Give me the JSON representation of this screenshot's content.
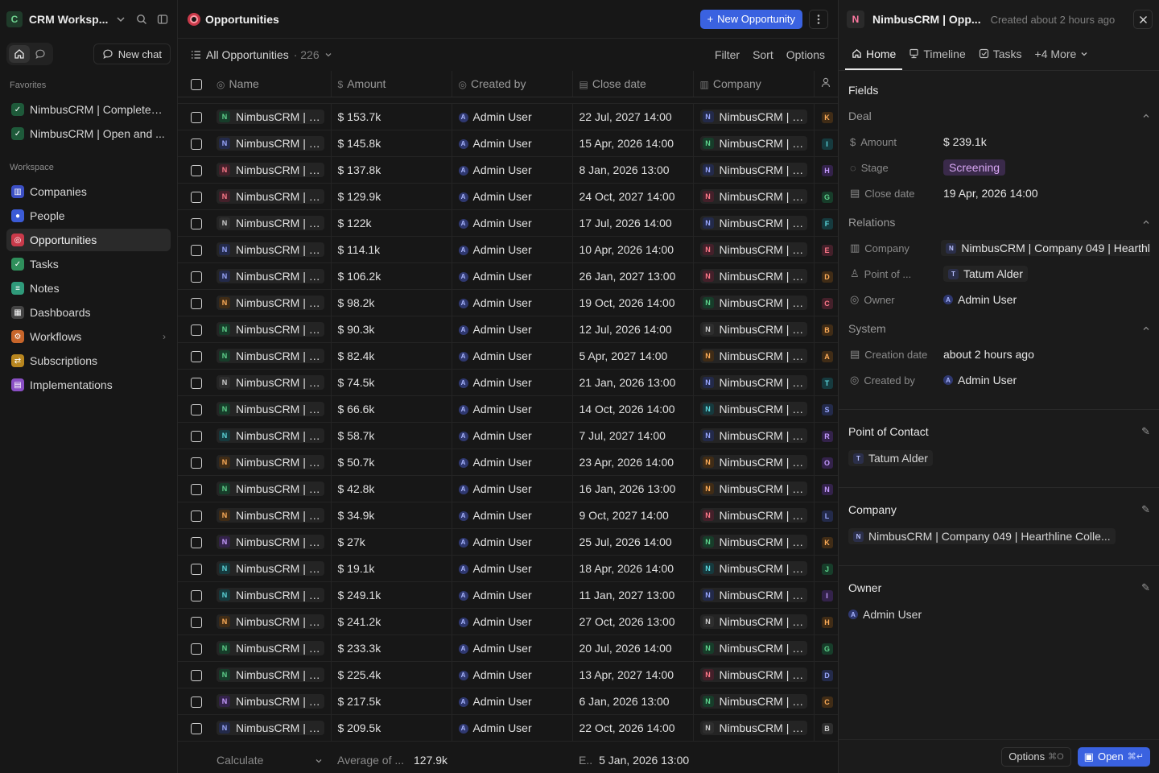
{
  "sidebar": {
    "workspace_initial": "C",
    "workspace_name": "CRM Worksp...",
    "new_chat_label": "New chat",
    "favorites_title": "Favorites",
    "favorites": [
      {
        "label": "NimbusCRM | Completed ...",
        "color": "#1e5a3a"
      },
      {
        "label": "NimbusCRM | Open and ...",
        "color": "#1e5a3a"
      }
    ],
    "workspace_title": "Workspace",
    "items": [
      {
        "label": "Companies",
        "icon": "building-icon",
        "color": "#3b4fc4",
        "glyph": "▥",
        "active": false,
        "chevron": ""
      },
      {
        "label": "People",
        "icon": "person-icon",
        "color": "#3b5bd6",
        "glyph": "●",
        "active": false,
        "chevron": ""
      },
      {
        "label": "Opportunities",
        "icon": "target-icon",
        "color": "#c93a4a",
        "glyph": "◎",
        "active": true,
        "chevron": ""
      },
      {
        "label": "Tasks",
        "icon": "checkbox-icon",
        "color": "#2f8f5b",
        "glyph": "✓",
        "active": false,
        "chevron": ""
      },
      {
        "label": "Notes",
        "icon": "note-icon",
        "color": "#2f9a7a",
        "glyph": "≡",
        "active": false,
        "chevron": ""
      },
      {
        "label": "Dashboards",
        "icon": "dashboard-icon",
        "color": "#444444",
        "glyph": "▦",
        "active": false,
        "chevron": ""
      },
      {
        "label": "Workflows",
        "icon": "workflow-icon",
        "color": "#c7652a",
        "glyph": "⚙",
        "active": false,
        "chevron": "›"
      },
      {
        "label": "Subscriptions",
        "icon": "subscription-icon",
        "color": "#b8861f",
        "glyph": "⇄",
        "active": false,
        "chevron": ""
      },
      {
        "label": "Implementations",
        "icon": "implementation-icon",
        "color": "#8a4fc4",
        "glyph": "▤",
        "active": false,
        "chevron": ""
      }
    ]
  },
  "main": {
    "title": "Opportunities",
    "new_button": "New Opportunity",
    "view_name": "All Opportunities",
    "view_count": "· 226",
    "filter": "Filter",
    "sort": "Sort",
    "options": "Options",
    "columns": [
      "Name",
      "Amount",
      "Created by",
      "Close date",
      "Company"
    ],
    "rows": [
      {
        "name": "NimbusCRM | Op...",
        "nc": "g",
        "amount": "$ 153.7k",
        "by": "Admin User",
        "date": "22 Jul, 2027 14:00",
        "company": "NimbusCRM | Co...",
        "cc": "b",
        "p": "K",
        "pc": "o"
      },
      {
        "name": "NimbusCRM | Op...",
        "nc": "b",
        "amount": "$ 145.8k",
        "by": "Admin User",
        "date": "15 Apr, 2026 14:00",
        "company": "NimbusCRM | Co...",
        "cc": "g",
        "p": "I",
        "pc": "c"
      },
      {
        "name": "NimbusCRM | Op...",
        "nc": "r",
        "amount": "$ 137.8k",
        "by": "Admin User",
        "date": "8 Jan, 2026 13:00",
        "company": "NimbusCRM | Co...",
        "cc": "b",
        "p": "H",
        "pc": "v"
      },
      {
        "name": "NimbusCRM | Op...",
        "nc": "r",
        "amount": "$ 129.9k",
        "by": "Admin User",
        "date": "24 Oct, 2027 14:00",
        "company": "NimbusCRM | Co...",
        "cc": "r",
        "p": "G",
        "pc": "g"
      },
      {
        "name": "NimbusCRM | Op...",
        "nc": "w",
        "amount": "$ 122k",
        "by": "Admin User",
        "date": "17 Jul, 2026 14:00",
        "company": "NimbusCRM | Co...",
        "cc": "b",
        "p": "F",
        "pc": "c"
      },
      {
        "name": "NimbusCRM | Op...",
        "nc": "b",
        "amount": "$ 114.1k",
        "by": "Admin User",
        "date": "10 Apr, 2026 14:00",
        "company": "NimbusCRM | Co...",
        "cc": "r",
        "p": "E",
        "pc": "r"
      },
      {
        "name": "NimbusCRM | Op...",
        "nc": "b",
        "amount": "$ 106.2k",
        "by": "Admin User",
        "date": "26 Jan, 2027 13:00",
        "company": "NimbusCRM | Co...",
        "cc": "r",
        "p": "D",
        "pc": "o"
      },
      {
        "name": "NimbusCRM | Op...",
        "nc": "o",
        "amount": "$ 98.2k",
        "by": "Admin User",
        "date": "19 Oct, 2026 14:00",
        "company": "NimbusCRM | Co...",
        "cc": "g",
        "p": "C",
        "pc": "r"
      },
      {
        "name": "NimbusCRM | Op...",
        "nc": "g",
        "amount": "$ 90.3k",
        "by": "Admin User",
        "date": "12 Jul, 2026 14:00",
        "company": "NimbusCRM | Co...",
        "cc": "w",
        "p": "B",
        "pc": "o"
      },
      {
        "name": "NimbusCRM | Op...",
        "nc": "g",
        "amount": "$ 82.4k",
        "by": "Admin User",
        "date": "5 Apr, 2027 14:00",
        "company": "NimbusCRM | Co...",
        "cc": "o",
        "p": "A",
        "pc": "o"
      },
      {
        "name": "NimbusCRM | Op...",
        "nc": "w",
        "amount": "$ 74.5k",
        "by": "Admin User",
        "date": "21 Jan, 2026 13:00",
        "company": "NimbusCRM | Co...",
        "cc": "b",
        "p": "T",
        "pc": "c"
      },
      {
        "name": "NimbusCRM | Op...",
        "nc": "g",
        "amount": "$ 66.6k",
        "by": "Admin User",
        "date": "14 Oct, 2026 14:00",
        "company": "NimbusCRM | Co...",
        "cc": "c",
        "p": "S",
        "pc": "b"
      },
      {
        "name": "NimbusCRM | Op...",
        "nc": "c",
        "amount": "$ 58.7k",
        "by": "Admin User",
        "date": "7 Jul, 2027 14:00",
        "company": "NimbusCRM | Co...",
        "cc": "b",
        "p": "R",
        "pc": "v"
      },
      {
        "name": "NimbusCRM | Op...",
        "nc": "o",
        "amount": "$ 50.7k",
        "by": "Admin User",
        "date": "23 Apr, 2026 14:00",
        "company": "NimbusCRM | Co...",
        "cc": "o",
        "p": "O",
        "pc": "v"
      },
      {
        "name": "NimbusCRM | Op...",
        "nc": "g",
        "amount": "$ 42.8k",
        "by": "Admin User",
        "date": "16 Jan, 2026 13:00",
        "company": "NimbusCRM | Co...",
        "cc": "o",
        "p": "N",
        "pc": "v"
      },
      {
        "name": "NimbusCRM | Op...",
        "nc": "o",
        "amount": "$ 34.9k",
        "by": "Admin User",
        "date": "9 Oct, 2027 14:00",
        "company": "NimbusCRM | Co...",
        "cc": "r",
        "p": "L",
        "pc": "b"
      },
      {
        "name": "NimbusCRM | Op...",
        "nc": "v",
        "amount": "$ 27k",
        "by": "Admin User",
        "date": "25 Jul, 2026 14:00",
        "company": "NimbusCRM | Co...",
        "cc": "g",
        "p": "K",
        "pc": "o"
      },
      {
        "name": "NimbusCRM | Op...",
        "nc": "c",
        "amount": "$ 19.1k",
        "by": "Admin User",
        "date": "18 Apr, 2026 14:00",
        "company": "NimbusCRM | Co...",
        "cc": "c",
        "p": "J",
        "pc": "g"
      },
      {
        "name": "NimbusCRM | Op...",
        "nc": "c",
        "amount": "$ 249.1k",
        "by": "Admin User",
        "date": "11 Jan, 2027 13:00",
        "company": "NimbusCRM | Co...",
        "cc": "b",
        "p": "I",
        "pc": "v"
      },
      {
        "name": "NimbusCRM | Op...",
        "nc": "o",
        "amount": "$ 241.2k",
        "by": "Admin User",
        "date": "27 Oct, 2026 13:00",
        "company": "NimbusCRM | Co...",
        "cc": "w",
        "p": "H",
        "pc": "o"
      },
      {
        "name": "NimbusCRM | Op...",
        "nc": "g",
        "amount": "$ 233.3k",
        "by": "Admin User",
        "date": "20 Jul, 2026 14:00",
        "company": "NimbusCRM | Co...",
        "cc": "g",
        "p": "G",
        "pc": "g"
      },
      {
        "name": "NimbusCRM | Op...",
        "nc": "g",
        "amount": "$ 225.4k",
        "by": "Admin User",
        "date": "13 Apr, 2027 14:00",
        "company": "NimbusCRM | Co...",
        "cc": "r",
        "p": "D",
        "pc": "b"
      },
      {
        "name": "NimbusCRM | Op...",
        "nc": "v",
        "amount": "$ 217.5k",
        "by": "Admin User",
        "date": "6 Jan, 2026 13:00",
        "company": "NimbusCRM | Co...",
        "cc": "g",
        "p": "C",
        "pc": "o"
      },
      {
        "name": "NimbusCRM | Op...",
        "nc": "b",
        "amount": "$ 209.5k",
        "by": "Admin User",
        "date": "22 Oct, 2026 14:00",
        "company": "NimbusCRM | Co...",
        "cc": "w",
        "p": "B",
        "pc": "w"
      }
    ],
    "footer": {
      "calculate": "Calculate",
      "average_label": "Average of ...",
      "average_value": "127.9k",
      "earliest_label": "E..",
      "earliest_value": "5 Jan, 2026 13:00"
    }
  },
  "panel": {
    "badge": "N",
    "title": "NimbusCRM | Opp...",
    "subtitle": "Created about 2 hours ago",
    "tabs": [
      "Home",
      "Timeline",
      "Tasks",
      "+4 More"
    ],
    "fields_title": "Fields",
    "deal_title": "Deal",
    "amount_label": "Amount",
    "amount_value": "$ 239.1k",
    "stage_label": "Stage",
    "stage_value": "Screening",
    "close_label": "Close date",
    "close_value": "19 Apr, 2026 14:00",
    "relations_title": "Relations",
    "company_label": "Company",
    "company_value": "NimbusCRM | Company 049 | Hearthl",
    "poc_label": "Point of ...",
    "poc_value": "Tatum Alder",
    "owner_label": "Owner",
    "owner_value": "Admin User",
    "system_title": "System",
    "creation_label": "Creation date",
    "creation_value": "about 2 hours ago",
    "createdby_label": "Created by",
    "createdby_value": "Admin User",
    "card_poc_title": "Point of Contact",
    "card_poc_value": "Tatum Alder",
    "card_company_title": "Company",
    "card_company_value": "NimbusCRM | Company 049 | Hearthline Colle...",
    "card_owner_title": "Owner",
    "card_owner_value": "Admin User",
    "options_label": "Options",
    "options_key": "⌘O",
    "open_label": "Open",
    "open_key": "⌘↵"
  },
  "colors": {
    "g": [
      "#173d2a",
      "#5fd38d"
    ],
    "b": [
      "#232a4a",
      "#9aa8ff"
    ],
    "r": [
      "#44202a",
      "#ff7a8a"
    ],
    "o": [
      "#402c16",
      "#ffae5a"
    ],
    "w": [
      "#2e2e2e",
      "#cfcfcf"
    ],
    "c": [
      "#163a3e",
      "#5cd6dc"
    ],
    "v": [
      "#33224a",
      "#c69cff"
    ]
  }
}
